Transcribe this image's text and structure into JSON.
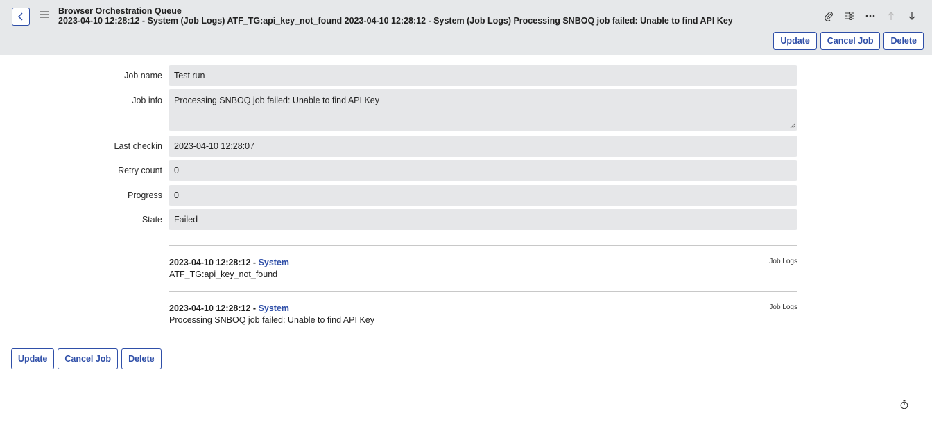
{
  "header": {
    "title_line1": "Browser Orchestration Queue",
    "title_line2": "2023-04-10 12:28:12 - System (Job Logs) ATF_TG:api_key_not_found 2023-04-10 12:28:12 - System (Job Logs) Processing SNBOQ job failed: Unable to find API Key",
    "buttons": {
      "update": "Update",
      "cancel_job": "Cancel Job",
      "delete": "Delete"
    },
    "icons": [
      "paperclip-icon",
      "settings-sliders-icon",
      "more-icon",
      "arrow-up-icon",
      "arrow-down-icon"
    ]
  },
  "form": {
    "job_name": {
      "label": "Job name",
      "value": "Test run"
    },
    "job_info": {
      "label": "Job info",
      "value": "Processing SNBOQ job failed: Unable to find API Key"
    },
    "last_checkin": {
      "label": "Last checkin",
      "value": "2023-04-10 12:28:07"
    },
    "retry_count": {
      "label": "Retry count",
      "value": "0"
    },
    "progress": {
      "label": "Progress",
      "value": "0"
    },
    "state": {
      "label": "State",
      "value": "Failed"
    }
  },
  "logs": [
    {
      "timestamp": "2023-04-10 12:28:12",
      "separator": " - ",
      "user": "System",
      "text": "ATF_TG:api_key_not_found",
      "tag": "Job Logs"
    },
    {
      "timestamp": "2023-04-10 12:28:12",
      "separator": " - ",
      "user": "System",
      "text": "Processing SNBOQ job failed: Unable to find API Key",
      "tag": "Job Logs"
    }
  ],
  "footer": {
    "buttons": {
      "update": "Update",
      "cancel_job": "Cancel Job",
      "delete": "Delete"
    }
  },
  "colors": {
    "accent": "#2f4fa8",
    "header_bg": "#e6e8ea",
    "field_bg": "#e6e7e9"
  }
}
